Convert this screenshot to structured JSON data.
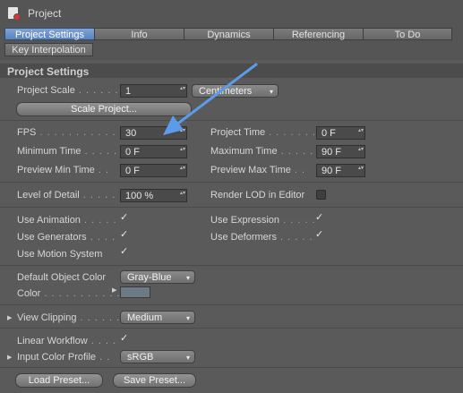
{
  "window": {
    "title": "Project"
  },
  "tabs": [
    {
      "label": "Project Settings"
    },
    {
      "label": "Info"
    },
    {
      "label": "Dynamics"
    },
    {
      "label": "Referencing"
    },
    {
      "label": "To Do"
    }
  ],
  "tab_row2": {
    "label": "Key Interpolation"
  },
  "section": {
    "title": "Project Settings"
  },
  "project_scale": {
    "label": "Project Scale",
    "value": "1",
    "unit": "Centimeters"
  },
  "scale_button": {
    "label": "Scale Project..."
  },
  "fps": {
    "label": "FPS",
    "value": "30"
  },
  "project_time": {
    "label": "Project Time",
    "value": "0 F"
  },
  "minimum_time": {
    "label": "Minimum Time",
    "value": "0 F"
  },
  "maximum_time": {
    "label": "Maximum Time",
    "value": "90 F"
  },
  "preview_min": {
    "label": "Preview Min Time",
    "value": "0 F"
  },
  "preview_max": {
    "label": "Preview Max Time",
    "value": "90 F"
  },
  "level_of_detail": {
    "label": "Level of Detail",
    "value": "100 %"
  },
  "render_lod": {
    "label": "Render LOD in Editor",
    "checked": false
  },
  "use_animation": {
    "label": "Use Animation",
    "checked": true
  },
  "use_expression": {
    "label": "Use Expression",
    "checked": true
  },
  "use_generators": {
    "label": "Use Generators",
    "checked": true
  },
  "use_deformers": {
    "label": "Use Deformers",
    "checked": true
  },
  "use_motion": {
    "label": "Use Motion System",
    "checked": true
  },
  "default_color": {
    "label": "Default Object Color",
    "value": "Gray-Blue"
  },
  "color": {
    "label": "Color",
    "swatch": "#6d7a86"
  },
  "view_clipping": {
    "label": "View Clipping",
    "value": "Medium"
  },
  "linear_workflow": {
    "label": "Linear Workflow",
    "checked": true
  },
  "input_color_profile": {
    "label": "Input Color Profile",
    "value": "sRGB"
  },
  "load_preset": {
    "label": "Load Preset..."
  },
  "save_preset": {
    "label": "Save Preset..."
  },
  "glyphs": {
    "check": "✓",
    "caret": "▾",
    "spin": "▴▾",
    "expand": "▶"
  },
  "colors": {
    "accent_tab": "#6b93cc",
    "annotation_arrow": "#5b9cea"
  }
}
